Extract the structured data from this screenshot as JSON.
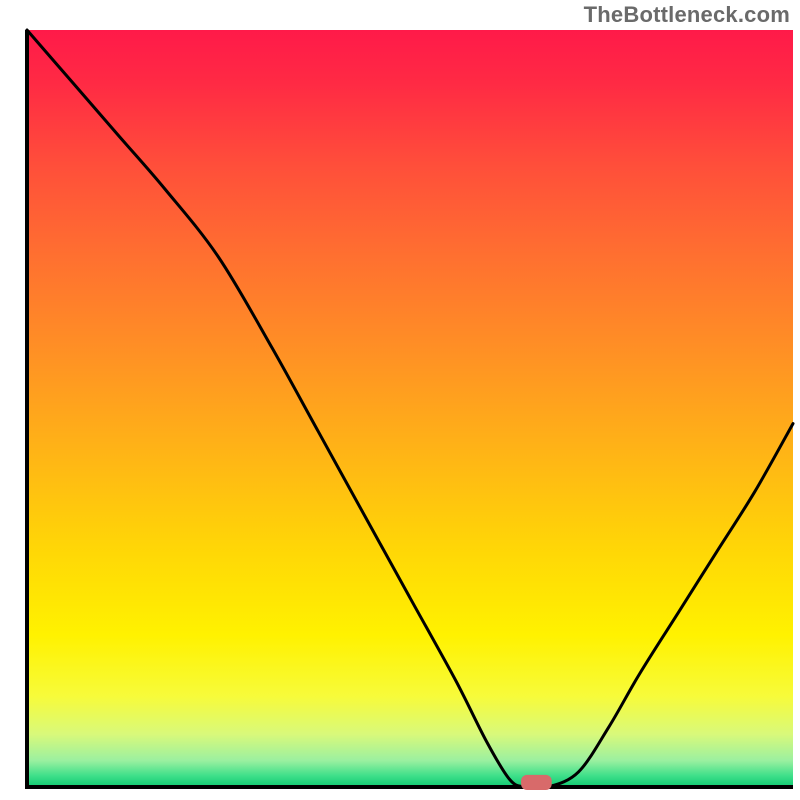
{
  "watermark": "TheBottleneck.com",
  "chart_data": {
    "type": "line",
    "title": "",
    "xlabel": "",
    "ylabel": "",
    "xlim": [
      0,
      100
    ],
    "ylim": [
      0,
      100
    ],
    "x": [
      0,
      6,
      12,
      18,
      25,
      32,
      38,
      44,
      50,
      56,
      60,
      63,
      65,
      68,
      72,
      76,
      80,
      85,
      90,
      95,
      100
    ],
    "values": [
      100,
      93,
      86,
      79,
      70,
      58,
      47,
      36,
      25,
      14,
      6,
      1,
      0,
      0,
      2,
      8,
      15,
      23,
      31,
      39,
      48
    ],
    "marker": {
      "x": 66.5,
      "y": 0,
      "w": 4,
      "h": 1.6
    },
    "gradient_stops": [
      {
        "offset": 0.0,
        "color": "#ff1a49"
      },
      {
        "offset": 0.07,
        "color": "#ff2a44"
      },
      {
        "offset": 0.18,
        "color": "#ff4f3a"
      },
      {
        "offset": 0.3,
        "color": "#ff7030"
      },
      {
        "offset": 0.42,
        "color": "#ff8f25"
      },
      {
        "offset": 0.55,
        "color": "#ffb217"
      },
      {
        "offset": 0.68,
        "color": "#ffd507"
      },
      {
        "offset": 0.8,
        "color": "#fff200"
      },
      {
        "offset": 0.88,
        "color": "#f7fb3a"
      },
      {
        "offset": 0.93,
        "color": "#d9f97a"
      },
      {
        "offset": 0.965,
        "color": "#9bf0a0"
      },
      {
        "offset": 0.985,
        "color": "#3fe08a"
      },
      {
        "offset": 1.0,
        "color": "#10c971"
      }
    ],
    "axis_color": "#000000",
    "curve_color": "#000000",
    "marker_color": "#d86a6a"
  }
}
